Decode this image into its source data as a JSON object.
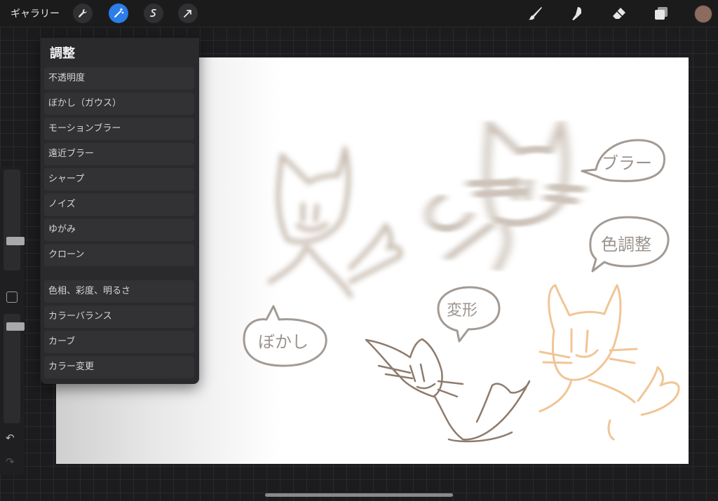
{
  "topbar": {
    "gallery_label": "ギャラリー",
    "tools_left": [
      "wrench-icon",
      "magic-wand-icon",
      "selection-icon",
      "transform-arrow-icon"
    ],
    "tools_right": [
      "brush-icon",
      "smudge-icon",
      "eraser-icon",
      "layers-icon"
    ],
    "active_tool": "magic-wand-icon",
    "current_color": "#8d6b5e",
    "accent_color": "#2b7de9"
  },
  "adjustments_menu": {
    "title": "調整",
    "group1": [
      "不透明度",
      "ぼかし（ガウス）",
      "モーションブラー",
      "遠近ブラー",
      "シャープ",
      "ノイズ",
      "ゆがみ",
      "クローン"
    ],
    "group2": [
      "色相、彩度、明るさ",
      "カラーバランス",
      "カーブ",
      "カラー変更"
    ]
  },
  "canvas": {
    "bubbles": {
      "blur": "ブラー",
      "color_adjust": "色調整",
      "transform": "変形",
      "gaussian": "ぼかし"
    },
    "colors": {
      "brown_sketch": "#8e7b6d",
      "peach_sketch": "#f1c595",
      "bubble_stroke": "#a29a94"
    }
  },
  "sidebar": {
    "brush_size_level": 0.45,
    "opacity_level": 0.9,
    "undo_icon": "undo-icon",
    "redo_icon": "redo-icon"
  }
}
